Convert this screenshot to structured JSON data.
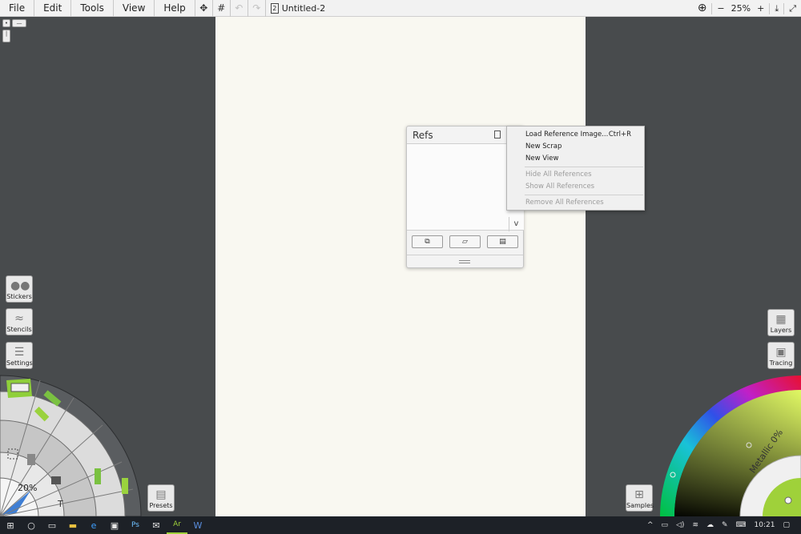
{
  "menu": {
    "items": [
      "File",
      "Edit",
      "Tools",
      "View",
      "Help"
    ]
  },
  "toolbar": {
    "move_icon": "✥",
    "grid_icon": "#",
    "undo_icon": "↶",
    "redo_icon": "↷",
    "doc_icon_glyph": "2",
    "document_title": "Untitled-2"
  },
  "zoom_controls": {
    "fit_icon": "⊕",
    "minus": "−",
    "zoom_level": "25%",
    "plus": "+",
    "download_icon": "⤓",
    "fullscreen_icon": "⤢"
  },
  "refs_panel": {
    "title": "Refs",
    "scroll_arrow": "v",
    "buttons": [
      "⧉",
      "▱",
      "▤"
    ]
  },
  "context_menu": {
    "items": [
      {
        "label": "Load Reference Image...",
        "shortcut": "Ctrl+R",
        "enabled": true
      },
      {
        "label": "New Scrap",
        "shortcut": "",
        "enabled": true
      },
      {
        "label": "New View",
        "shortcut": "",
        "enabled": true
      },
      {
        "label": "Hide All References",
        "shortcut": "",
        "enabled": false
      },
      {
        "label": "Show All References",
        "shortcut": "",
        "enabled": false
      },
      {
        "label": "Remove All References",
        "shortcut": "",
        "enabled": false
      }
    ]
  },
  "left_buttons": {
    "stickers": "Stickers",
    "stencils": "Stencils",
    "settings": "Settings",
    "presets": "Presets"
  },
  "right_buttons": {
    "layers": "Layers",
    "tracing": "Tracing",
    "samples": "Samples"
  },
  "tool_wheel": {
    "zoom_percent": "20%",
    "text_tool": "T"
  },
  "color_wheel": {
    "metallic_label": "Metallic 0%",
    "accent_color": "#9fd13a"
  },
  "taskbar": {
    "time": "10:21",
    "apps": [
      "⊞",
      "○",
      "▭",
      "▬",
      "e",
      "▣",
      "Ps",
      "✉",
      "Ar",
      "W"
    ]
  }
}
